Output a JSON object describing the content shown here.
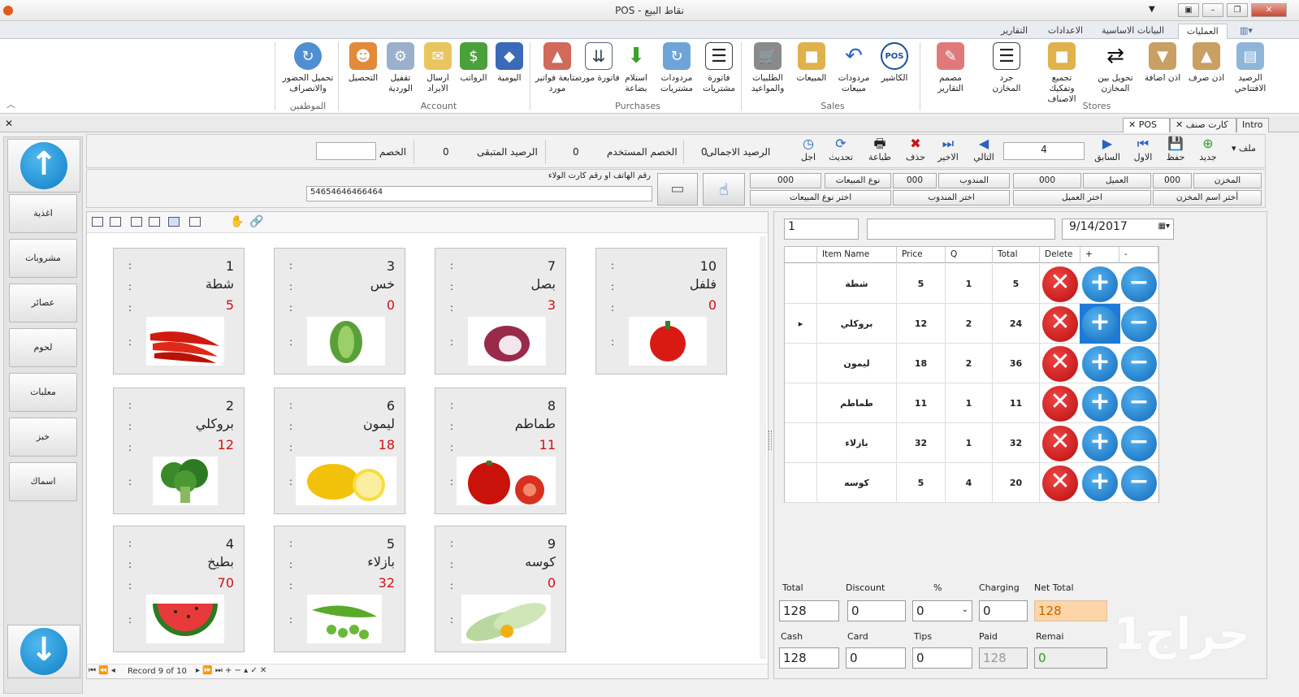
{
  "window": {
    "title": "POS - نقاط البيع"
  },
  "ribbon_tabs": [
    "العمليات",
    "البيانات الاساسية",
    "الاعدادات",
    "التقارير"
  ],
  "ribbon": {
    "groups": [
      {
        "name": "Stores",
        "items": [
          "الرصيد الافتتاحي",
          "اذن صرف",
          "اذن اضافة",
          "تحويل بين المخازن",
          "تجميع وتفكيك الاصناف",
          "جرد المخازن",
          "مصمم التقارير"
        ]
      },
      {
        "name": "Sales",
        "items": [
          "الكاشير",
          "مردودات مبيعات",
          "المبيعات",
          "الطلبيات والمواعيد"
        ]
      },
      {
        "name": "Purchases",
        "items": [
          "فاتورة مشتريات",
          "مردودات مشتريات",
          "استلام بضاعة",
          "فاتورة مورد",
          "متابعة فواتير مورد"
        ]
      },
      {
        "name": "Account",
        "items": [
          "اليومية",
          "الرواتب",
          "ارسال الايراد",
          "تقفيل الوردية",
          "التحصيل"
        ]
      },
      {
        "name": "الموظفين",
        "items": [
          "تحميل الحضور والانصراف"
        ]
      }
    ]
  },
  "doc_tabs": [
    "Intro",
    "كارت صنف",
    "POS"
  ],
  "categories": [
    "اغذية",
    "مشروبات",
    "عصائر",
    "لحوم",
    "معلبات",
    "خبز",
    "اسماك"
  ],
  "toolbar": {
    "file": "ملف",
    "new": "جديد",
    "save": "حفظ",
    "first": "الاول",
    "prev": "السابق",
    "record": "4",
    "next": "التالي",
    "last": "الاخير",
    "delete": "حذف",
    "print": "طباعة",
    "refresh": "تحديث",
    "defer": "اجل",
    "total_balance_label": "الرصيد الاجمالى",
    "total_balance": "0",
    "used_discount_label": "الخصم المستخدم",
    "used_discount": "0",
    "remaining_balance_label": "الرصيد المتبقى",
    "remaining_balance": "0",
    "discount_label": "الخصم"
  },
  "filters": {
    "phone_label": "رقم الهاتف او رقم كارت الولاء",
    "phone_value": "54654646466464",
    "store_label": "المخزن",
    "store_code": "000",
    "store_pick": "أختر اسم المخزن",
    "customer_label": "العميل",
    "customer_code": "000",
    "customer_pick": "اختر العميل",
    "rep_label": "المندوب",
    "rep_code": "000",
    "rep_pick": "اختر المندوب",
    "sale_type_label": "نوع المبيعات",
    "sale_type_code": "000",
    "sale_type_pick": "اختر نوع المبيعات"
  },
  "products": [
    {
      "num": "10",
      "name": "فلفل",
      "price": "0"
    },
    {
      "num": "7",
      "name": "بصل",
      "price": "3"
    },
    {
      "num": "3",
      "name": "خس",
      "price": "0"
    },
    {
      "num": "1",
      "name": "شطة",
      "price": "5"
    },
    {
      "num": "8",
      "name": "طماطم",
      "price": "11"
    },
    {
      "num": "6",
      "name": "ليمون",
      "price": "18"
    },
    {
      "num": "2",
      "name": "بروكلي",
      "price": "12"
    },
    {
      "num": "9",
      "name": "كوسه",
      "price": "0"
    },
    {
      "num": "5",
      "name": "بازلاء",
      "price": "32"
    },
    {
      "num": "4",
      "name": "بطيخ",
      "price": "70"
    }
  ],
  "grid_nav": {
    "record_text": "Record 9 of 10"
  },
  "order": {
    "number": "1",
    "date": "9/14/2017",
    "columns": [
      "Item Name",
      "Price",
      "Q",
      "Total",
      "Delete",
      "+",
      "-"
    ],
    "rows": [
      {
        "item": "شطة",
        "price": "5",
        "q": "1",
        "total": "5"
      },
      {
        "item": "بروكلي",
        "price": "12",
        "q": "2",
        "total": "24"
      },
      {
        "item": "ليمون",
        "price": "18",
        "q": "2",
        "total": "36"
      },
      {
        "item": "طماطم",
        "price": "11",
        "q": "1",
        "total": "11"
      },
      {
        "item": "بازلاء",
        "price": "32",
        "q": "1",
        "total": "32"
      },
      {
        "item": "كوسه",
        "price": "5",
        "q": "4",
        "total": "20"
      }
    ]
  },
  "totals": {
    "total_label": "Total",
    "total": "128",
    "discount_label": "Discount",
    "discount": "0",
    "percent_label": "%",
    "percent": "0",
    "charging_label": "Charging",
    "charging": "0",
    "net_label": "Net Total",
    "net": "128",
    "cash_label": "Cash",
    "cash": "128",
    "card_label": "Card",
    "card": "0",
    "tips_label": "Tips",
    "tips": "0",
    "paid_label": "Paid",
    "paid": "128",
    "remain_label": "Remai",
    "remain": "0"
  },
  "watermark": "حراج1"
}
